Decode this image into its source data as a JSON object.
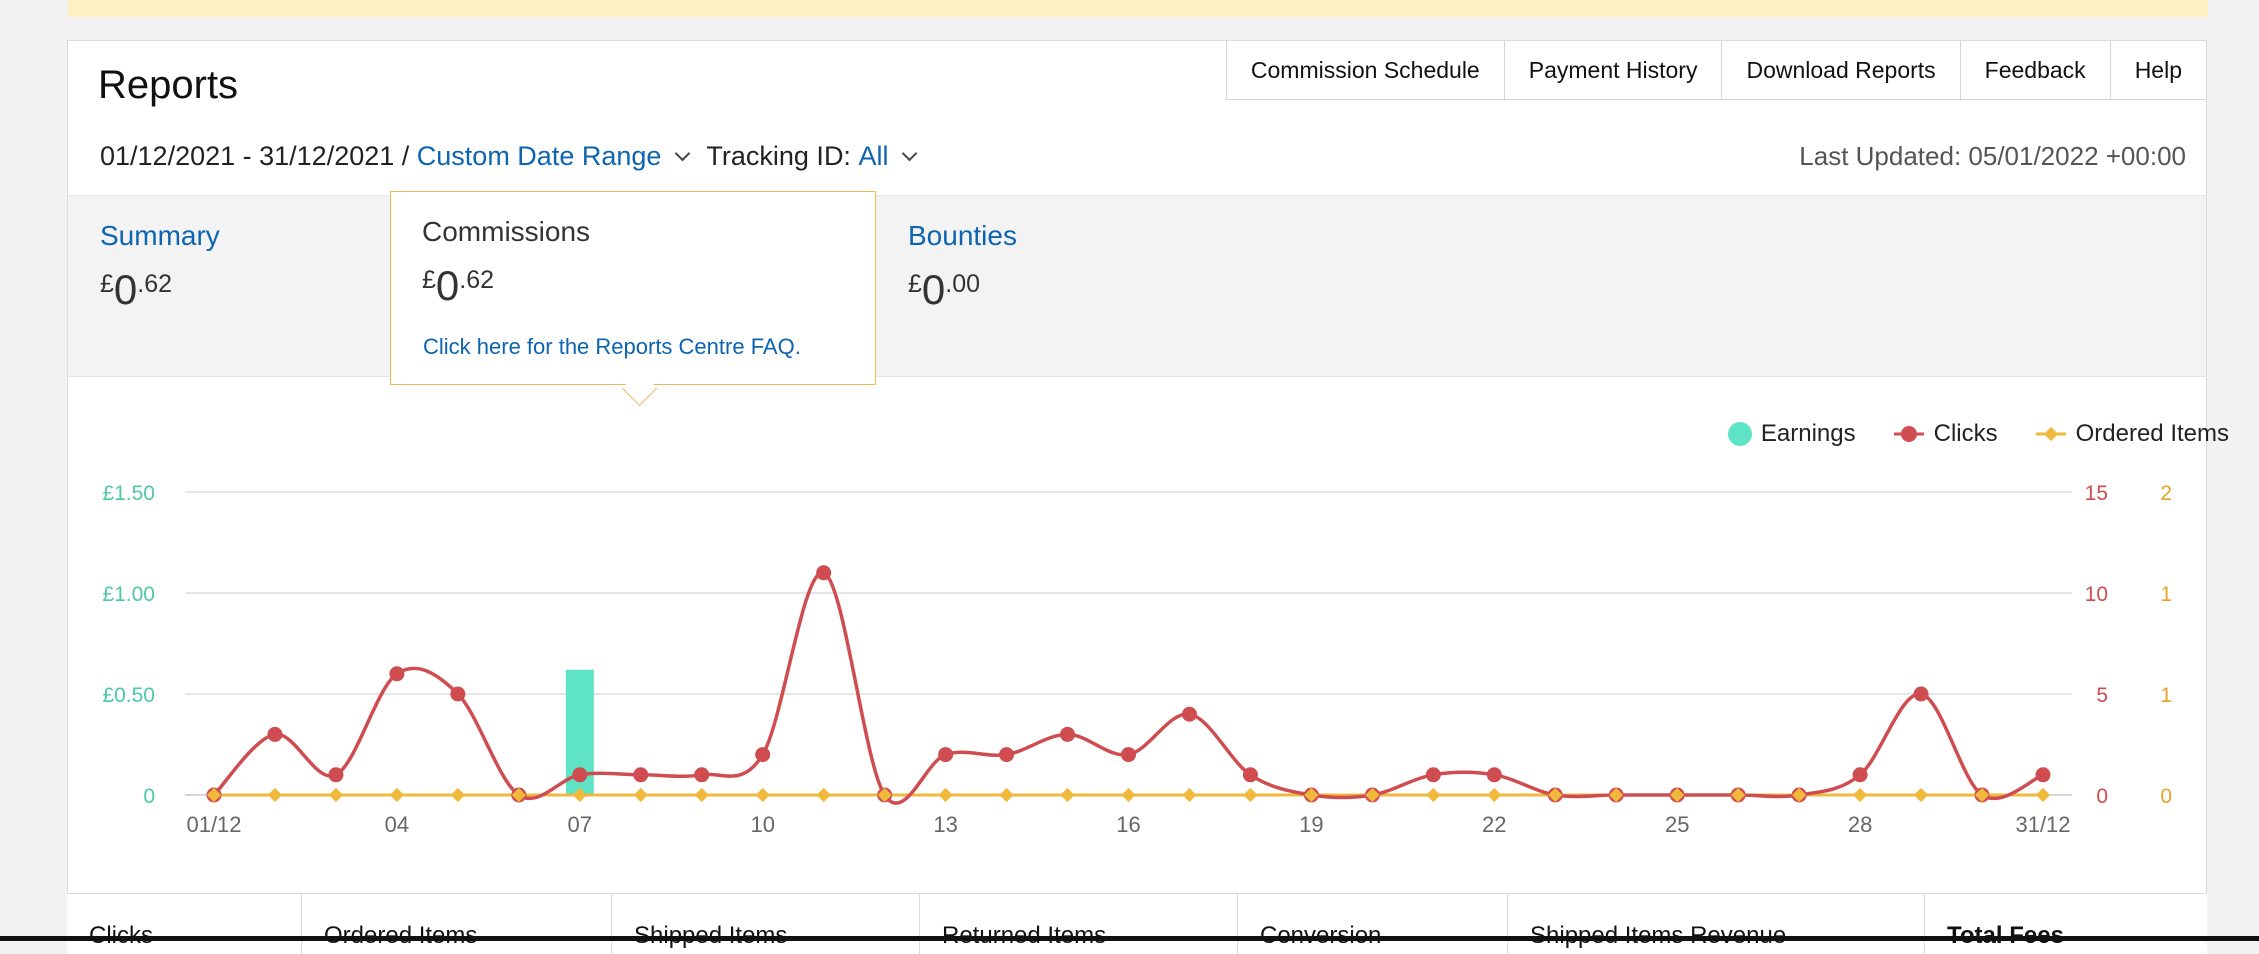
{
  "header": {
    "title": "Reports",
    "nav": [
      "Commission Schedule",
      "Payment History",
      "Download Reports",
      "Feedback",
      "Help"
    ],
    "date_range": "01/12/2021 - 31/12/2021 /",
    "date_range_link": "Custom Date Range",
    "tracking_label": "Tracking ID:",
    "tracking_value": "All",
    "last_updated": "Last Updated: 05/01/2022 +00:00"
  },
  "tabs": [
    {
      "label": "Summary",
      "currency": "£",
      "whole": "0",
      "decimal": ".62"
    },
    {
      "label": "Commissions",
      "currency": "£",
      "whole": "0",
      "decimal": ".62",
      "faq": "Click here for the Reports Centre FAQ."
    },
    {
      "label": "Bounties",
      "currency": "£",
      "whole": "0",
      "decimal": ".00"
    }
  ],
  "colors": {
    "earnings": "#5ee3c4",
    "clicks": "#cf4c50",
    "ordered": "#f0b93b",
    "link": "#0d64b1"
  },
  "chart_data": {
    "type": "line",
    "categories": [
      "01/12",
      "02/12",
      "03/12",
      "04/12",
      "05/12",
      "06/12",
      "07/12",
      "08/12",
      "09/12",
      "10/12",
      "11/12",
      "12/12",
      "13/12",
      "14/12",
      "15/12",
      "16/12",
      "17/12",
      "18/12",
      "19/12",
      "20/12",
      "21/12",
      "22/12",
      "23/12",
      "24/12",
      "25/12",
      "26/12",
      "27/12",
      "28/12",
      "29/12",
      "30/12",
      "31/12"
    ],
    "x_tick_labels": [
      "01/12",
      "04",
      "07",
      "10",
      "13",
      "16",
      "19",
      "22",
      "25",
      "28",
      "31/12"
    ],
    "legend": [
      "Earnings",
      "Clicks",
      "Ordered Items"
    ],
    "legend_position": "top-right",
    "series": [
      {
        "name": "Earnings",
        "type": "bar",
        "axis": "left",
        "values": [
          0,
          0,
          0,
          0,
          0,
          0,
          0.62,
          0,
          0,
          0,
          0,
          0,
          0,
          0,
          0,
          0,
          0,
          0,
          0,
          0,
          0,
          0,
          0,
          0,
          0,
          0,
          0,
          0,
          0,
          0,
          0
        ]
      },
      {
        "name": "Clicks",
        "type": "line",
        "axis": "right",
        "values": [
          0,
          3,
          1,
          6,
          5,
          0,
          1,
          1,
          1,
          2,
          11,
          0,
          2,
          2,
          3,
          2,
          4,
          1,
          0,
          0,
          1,
          1,
          0,
          0,
          0,
          0,
          0,
          1,
          5,
          0,
          1
        ]
      },
      {
        "name": "Ordered Items",
        "type": "line",
        "axis": "right2",
        "values": [
          0,
          0,
          0,
          0,
          0,
          0,
          0,
          0,
          0,
          0,
          0,
          0,
          0,
          0,
          0,
          0,
          0,
          0,
          0,
          0,
          0,
          0,
          0,
          0,
          0,
          0,
          0,
          0,
          0,
          0,
          0
        ]
      }
    ],
    "left_axis": {
      "ticks": [
        "0",
        "£0.50",
        "£1.00",
        "£1.50"
      ],
      "ylim": [
        0,
        1.5
      ]
    },
    "right_axis": {
      "ticks": [
        "0",
        "5",
        "10",
        "15"
      ],
      "ylim": [
        0,
        15
      ]
    },
    "right2_axis": {
      "ticks": [
        "0",
        "1",
        "1",
        "2"
      ]
    },
    "grid": true
  },
  "table_headers": [
    "Clicks",
    "Ordered Items",
    "Shipped Items",
    "Returned Items",
    "Conversion",
    "Shipped Items Revenue",
    "Total Fees"
  ]
}
